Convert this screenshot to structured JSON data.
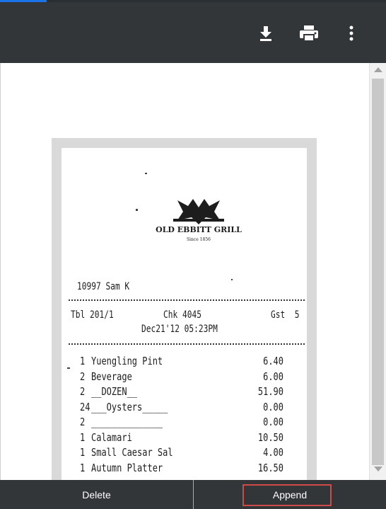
{
  "toolbar": {
    "download_icon": "download-icon",
    "print_icon": "print-icon",
    "more_icon": "more-vert-icon",
    "background": "#323639"
  },
  "receipt": {
    "logo_text": "OLD EBBITT GRILL",
    "logo_subtext": "Since 1856",
    "server_line": "10997 Sam K",
    "table_label": "Tbl 201/1",
    "check_label": "Chk 4045",
    "guest_label": "Gst  5",
    "datetime": "Dec21'12 05:23PM",
    "items": [
      {
        "qty": "1",
        "desc": "Yuengling Pint",
        "amount": "6.40"
      },
      {
        "qty": "2",
        "desc": "Beverage",
        "amount": "6.00"
      },
      {
        "qty": "2",
        "desc": "__DOZEN__",
        "amount": "51.90"
      },
      {
        "qty": "24",
        "desc": "___Oysters_____",
        "amount": "0.00"
      },
      {
        "qty": "2",
        "desc": "______________",
        "amount": "0.00"
      },
      {
        "qty": "1",
        "desc": "Calamari",
        "amount": "10.50"
      },
      {
        "qty": "1",
        "desc": "Small Caesar Sal",
        "amount": "4.00"
      },
      {
        "qty": "1",
        "desc": "Autumn Platter",
        "amount": "16.50"
      }
    ]
  },
  "footer": {
    "delete_label": "Delete",
    "append_label": "Append",
    "highlight_color": "#d14a4a"
  }
}
